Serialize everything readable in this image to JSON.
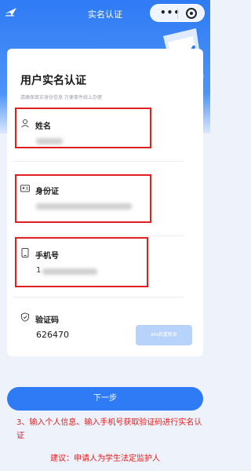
{
  "nav": {
    "title": "实名认证"
  },
  "card": {
    "title": "用户实名认证",
    "subtitle": "请确保真实身份信息 方便事件线上办理"
  },
  "fields": {
    "name_label": "姓名",
    "id_label": "身份证",
    "phone_label": "手机号",
    "phone_prefix": "1",
    "code_label": "验证码",
    "code_value": "626470"
  },
  "buttons": {
    "resend": "44s后重新发",
    "next": "下一步"
  },
  "annotation": {
    "line": "3、输入个人信息、输入手机号获取验证码进行实名认证",
    "hint": "建议：申请人为学生法定监护人"
  },
  "colors": {
    "accent": "#2f7bf5",
    "highlight": "#e02020"
  }
}
